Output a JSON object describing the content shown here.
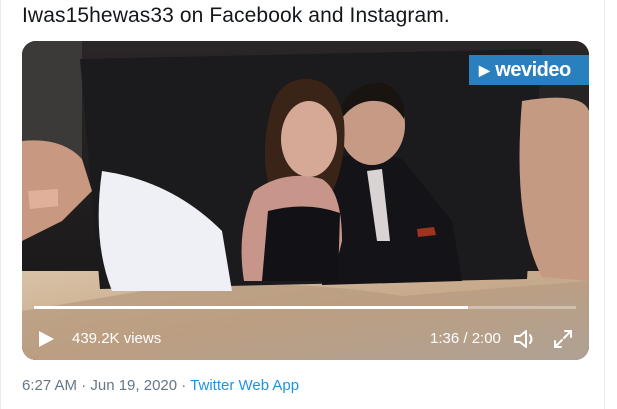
{
  "tweet": {
    "text": "Iwas15hewas33 on Facebook and Instagram.",
    "timestamp": "6:27 AM · Jun 19, 2020 · ",
    "source": "Twitter Web App"
  },
  "video": {
    "watermark": "wevideo",
    "views": "439.2K views",
    "time": "1:36 / 2:00",
    "progress": 0.8,
    "icons": {
      "play": "play-icon",
      "volume": "volume-icon",
      "fullscreen": "fullscreen-icon"
    }
  }
}
